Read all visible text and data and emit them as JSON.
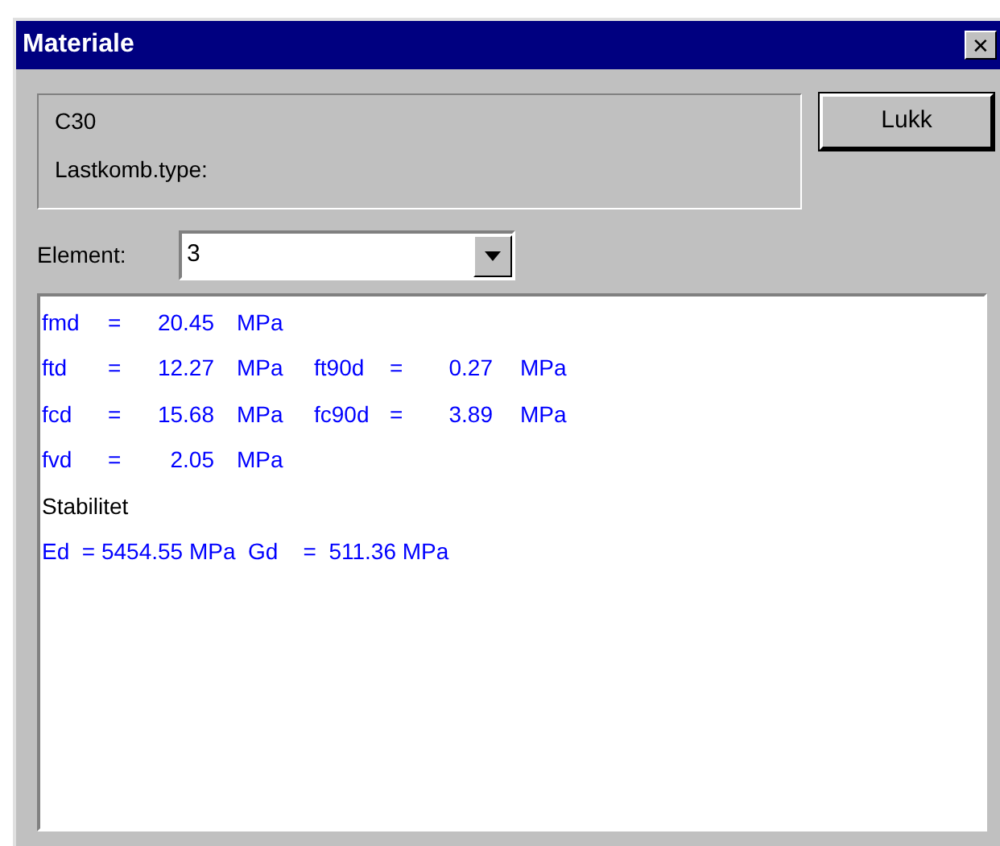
{
  "window": {
    "title": "Materiale",
    "close": "✕"
  },
  "info_group": {
    "material": "C30",
    "load_combination_label": "Lastkomb.type:"
  },
  "close_button": {
    "label": "Lukk"
  },
  "element_selector": {
    "label": "Element:",
    "value": "3"
  },
  "results": [
    {
      "kind": "values",
      "cells": [
        "fmd",
        "=",
        "20.45",
        "MPa"
      ]
    },
    {
      "kind": "values",
      "cells": [
        "ftd",
        "=",
        "12.27",
        "MPa",
        "ft90d",
        "=",
        "0.27",
        "MPa"
      ]
    },
    {
      "kind": "values",
      "cells": [
        "fcd",
        "=",
        "15.68",
        "MPa",
        "fc90d",
        "=",
        "3.89",
        "MPa"
      ]
    },
    {
      "kind": "values",
      "cells": [
        "fvd",
        "=",
        "2.05",
        "MPa"
      ]
    },
    {
      "kind": "heading",
      "text": "Stabilitet"
    },
    {
      "kind": "line",
      "text": "Ed  = 5454.55 MPa  Gd    =  511.36 MPa"
    }
  ]
}
